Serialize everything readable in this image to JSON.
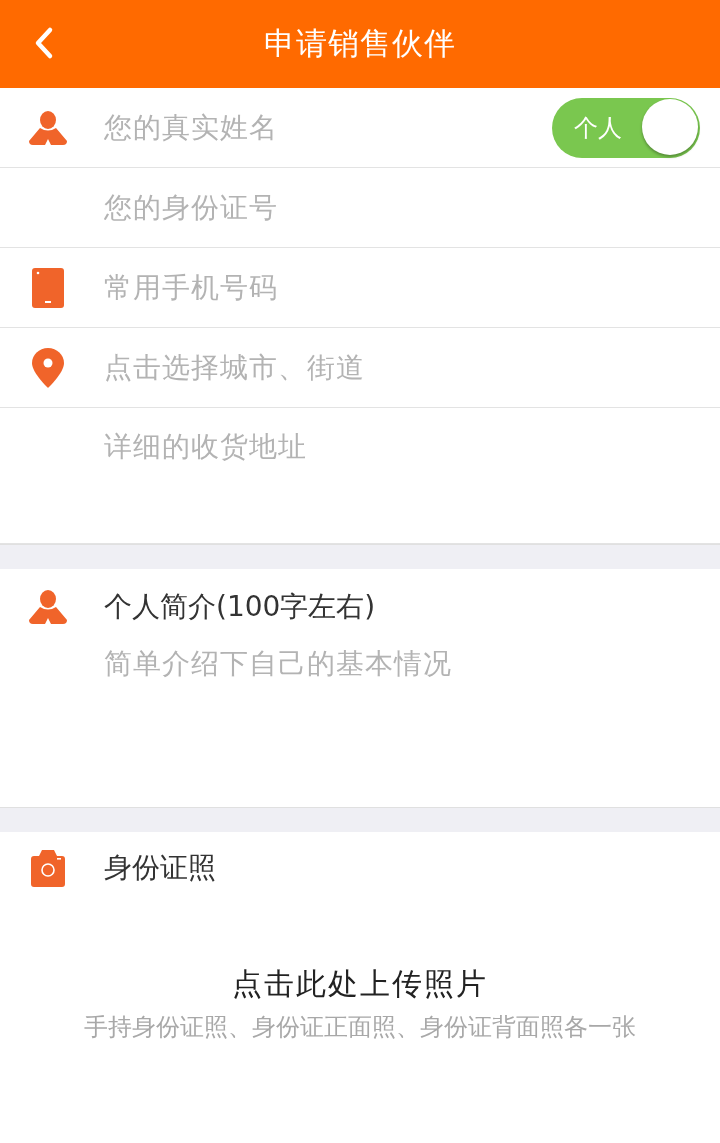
{
  "header": {
    "title": "申请销售伙伴"
  },
  "fields": [
    {
      "kind": "line",
      "placeholder": "您的真实姓名",
      "toggle": {
        "label": "个人",
        "on": true
      }
    },
    {
      "kind": "line",
      "placeholder": "您的身份证号"
    },
    {
      "kind": "line",
      "placeholder": "常用手机号码"
    },
    {
      "kind": "line",
      "placeholder": "点击选择城市、街道"
    },
    {
      "kind": "area",
      "placeholder": "详细的收货地址"
    }
  ],
  "intro": {
    "title": "个人简介(100字左右)",
    "placeholder": "简单介绍下自己的基本情况"
  },
  "photos": {
    "title": "身份证照",
    "upload_label": "点击此处上传照片",
    "hint": "手持身份证照、身份证正面照、身份证背面照各一张"
  }
}
